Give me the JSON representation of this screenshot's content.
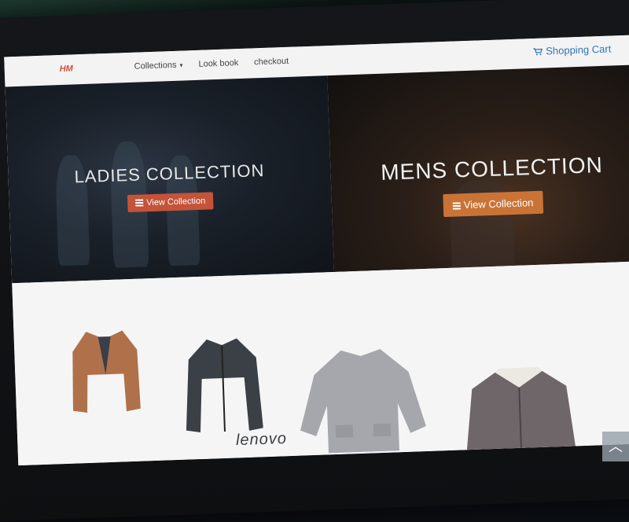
{
  "nav": {
    "logo": "HM",
    "links": [
      {
        "label": "Collections",
        "has_caret": true
      },
      {
        "label": "Look book"
      },
      {
        "label": "checkout"
      }
    ],
    "cart_label": "Shopping Cart"
  },
  "hero": {
    "ladies": {
      "title": "LADIES COLLECTION",
      "button": "View Collection"
    },
    "mens": {
      "title": "MENS COLLECTION",
      "button": "View Collection"
    },
    "next_arrow": "▸"
  },
  "products": [
    {
      "name": "brown blazer"
    },
    {
      "name": "dark fleece jacket"
    },
    {
      "name": "grey coat"
    },
    {
      "name": "leather jacket"
    }
  ],
  "scroll_top_icon": "up-chevron",
  "scroll_top_glyph": "︿",
  "laptop_brand": "lenovo",
  "colors": {
    "accent_red": "#c4533a",
    "accent_orange": "#c97436",
    "cart_blue": "#2f78b5"
  }
}
